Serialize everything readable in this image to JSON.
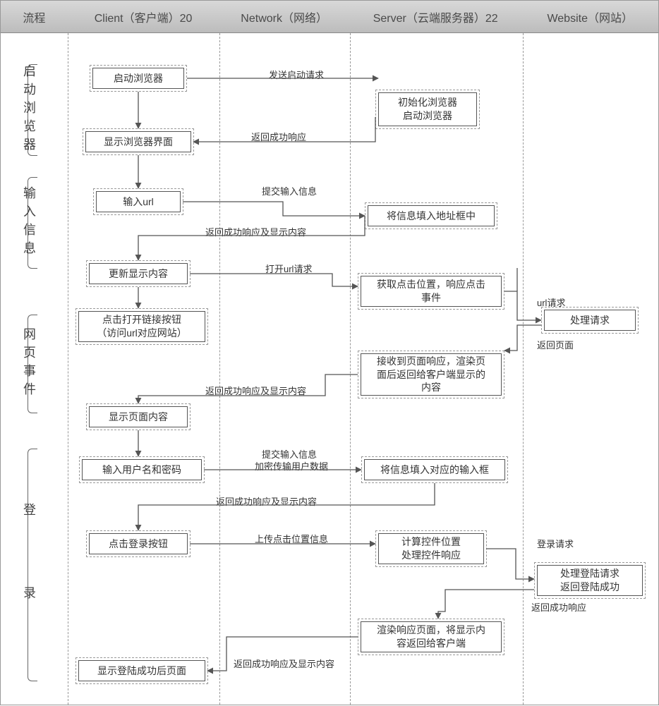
{
  "header": {
    "col_process": "流程",
    "col_client": "Client（客户端）20",
    "col_network": "Network（网络）",
    "col_server": "Server（云端服务器）22",
    "col_website": "Website（网站）"
  },
  "phases": {
    "p1": "启动浏览器",
    "p2": "输入信息",
    "p3": "网页事件",
    "p4": "登\n录"
  },
  "nodes": {
    "c1": "启动浏览器",
    "s1": "初始化浏览器\n启动浏览器",
    "c2": "显示浏览器界面",
    "c3": "输入url",
    "s3": "将信息填入地址框中",
    "c4": "更新显示内容",
    "s4": "获取点击位置，响应点击\n事件",
    "c5": "点击打开链接按钮\n（访问url对应网站）",
    "w1": "处理请求",
    "s5": "接收到页面响应，渲染页\n面后返回给客户端显示的\n内容",
    "c6": "显示页面内容",
    "c7": "输入用户名和密码",
    "s7": "将信息填入对应的输入框",
    "c8": "点击登录按钮",
    "s8": "计算控件位置\n处理控件响应",
    "w2": "处理登陆请求\n返回登陆成功",
    "s9": "渲染响应页面，将显示内\n容返回给客户端",
    "c9": "显示登陆成功后页面"
  },
  "msgs": {
    "m1": "发送启动请求",
    "m2": "返回成功响应",
    "m3": "提交输入信息",
    "m4": "返回成功响应及显示内容",
    "m5": "打开url请求",
    "m6": "url请求",
    "m7": "返回页面",
    "m8": "返回成功响应及显示内容",
    "m9a": "提交输入信息",
    "m9b": "加密传输用户数据",
    "m10": "返回成功响应及显示内容",
    "m11": "上传点击位置信息",
    "m12": "登录请求",
    "m13": "返回成功响应",
    "m14": "返回成功响应及显示内容"
  }
}
